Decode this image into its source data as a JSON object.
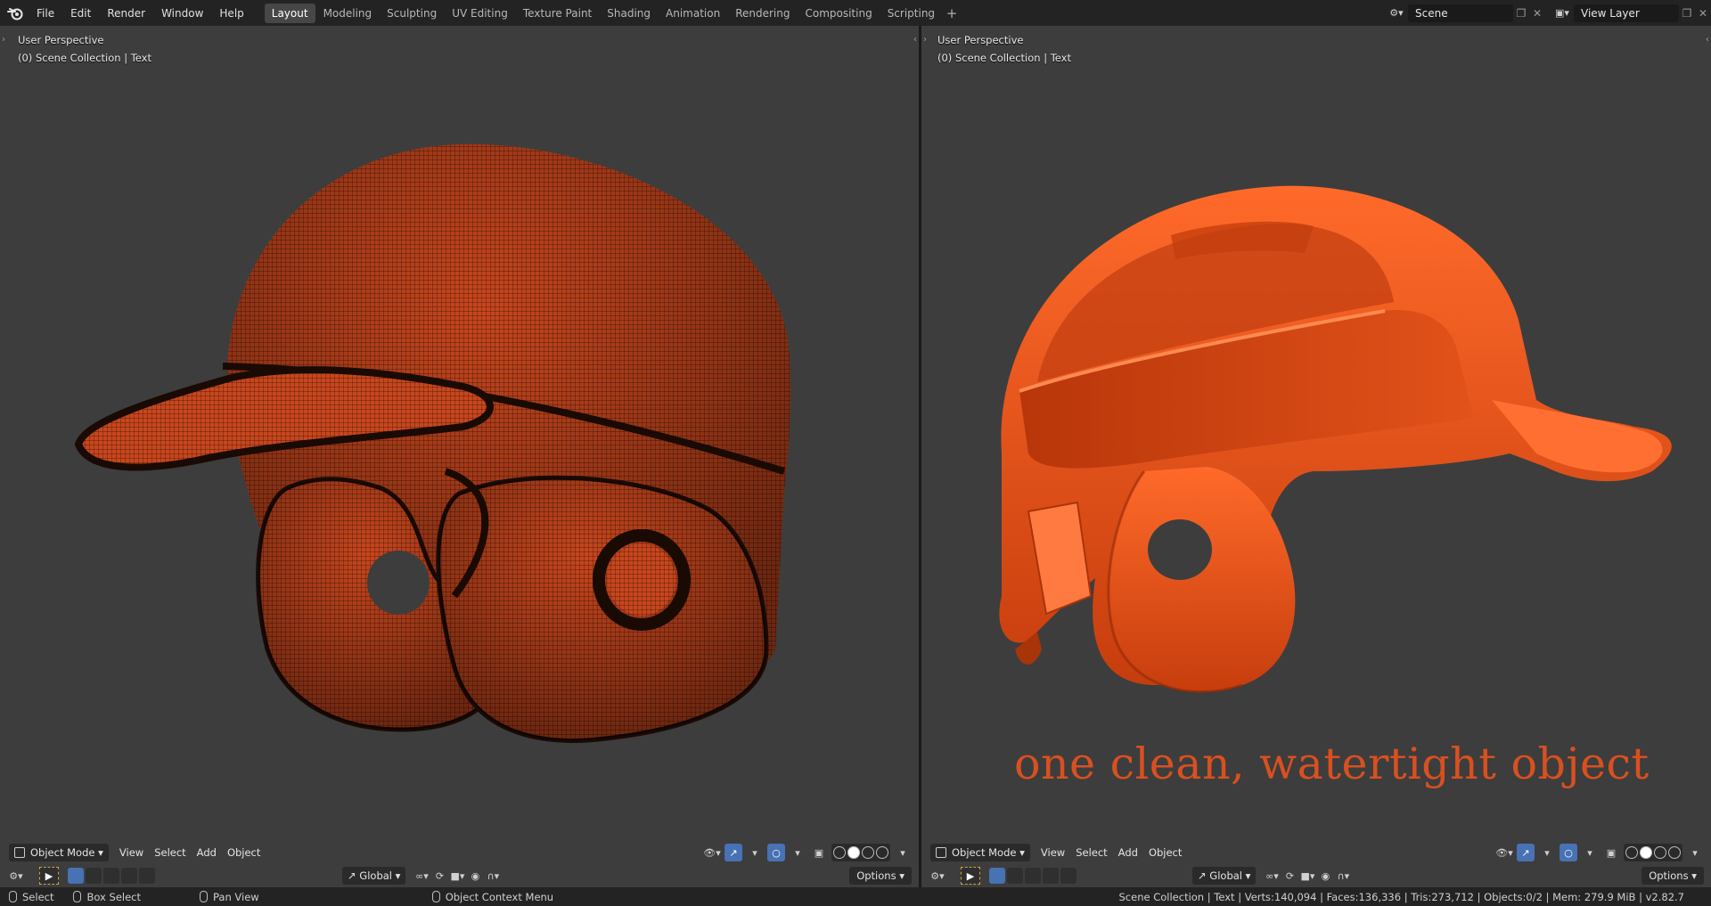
{
  "menu": {
    "items": [
      "File",
      "Edit",
      "Render",
      "Window",
      "Help"
    ]
  },
  "workspaces": {
    "tabs": [
      "Layout",
      "Modeling",
      "Sculpting",
      "UV Editing",
      "Texture Paint",
      "Shading",
      "Animation",
      "Rendering",
      "Compositing",
      "Scripting"
    ],
    "active": "Layout",
    "add": "+"
  },
  "scene": {
    "name": "Scene"
  },
  "view_layer": {
    "name": "View Layer"
  },
  "viewport_left": {
    "perspective": "User Perspective",
    "collection": "(0) Scene Collection | Text"
  },
  "viewport_right": {
    "perspective": "User Perspective",
    "collection": "(0) Scene Collection | Text",
    "caption": "one clean, watertight object"
  },
  "toolbar": {
    "mode": "Object Mode",
    "view": "View",
    "select": "Select",
    "add": "Add",
    "object": "Object",
    "orientation": "Global",
    "options": "Options"
  },
  "statusbar": {
    "select": "Select",
    "box_select": "Box Select",
    "pan_view": "Pan View",
    "context_menu": "Object Context Menu",
    "stats": "Scene Collection | Text | Verts:140,094 | Faces:136,336 | Tris:273,712 | Objects:0/2 | Mem: 279.9 MiB | v2.82.7"
  },
  "colors": {
    "accent": "#4772b3",
    "helmet": "#d64a1a",
    "caption": "#d9501f",
    "viewport_bg": "#3d3d3d"
  }
}
